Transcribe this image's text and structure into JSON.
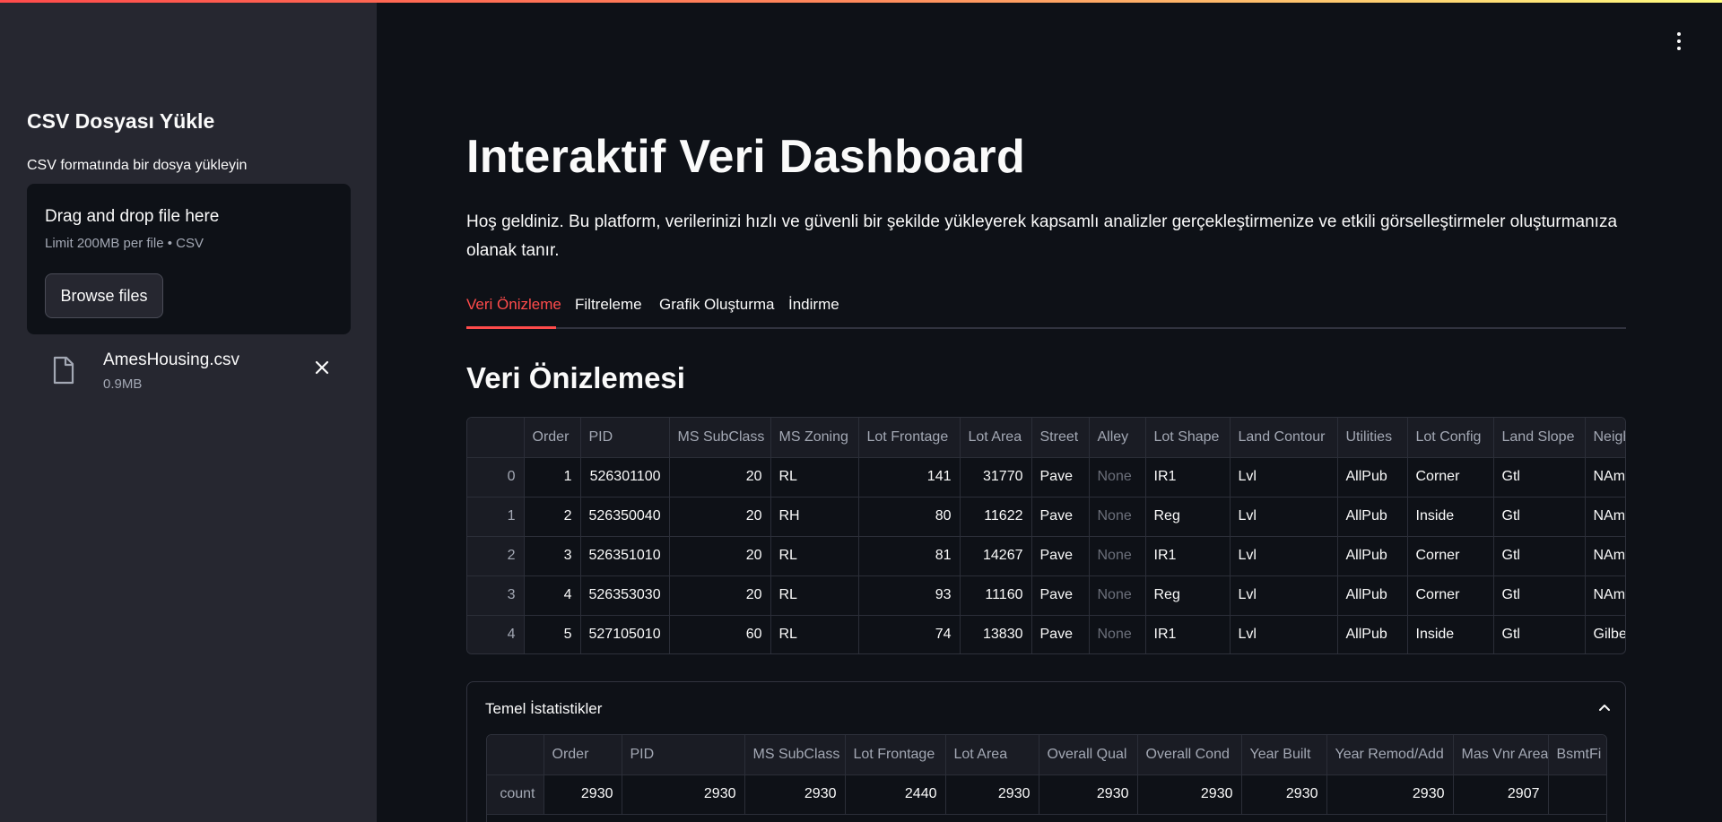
{
  "sidebar": {
    "title": "CSV Dosyası Yükle",
    "upload_label": "CSV formatında bir dosya yükleyin",
    "dropzone": {
      "title": "Drag and drop file here",
      "limit": "Limit 200MB per file • CSV",
      "browse_label": "Browse files"
    },
    "file": {
      "name": "AmesHousing.csv",
      "size": "0.9MB",
      "icon": "file-icon",
      "remove_icon": "close-icon"
    }
  },
  "main": {
    "title": "Interaktif Veri Dashboard",
    "intro": "Hoş geldiniz. Bu platform, verilerinizi hızlı ve güvenli bir şekilde yükleyerek kapsamlı analizler gerçekleştirmenize ve etkili görselleştirmeler oluşturmanıza olanak tanır.",
    "tabs": [
      {
        "label": "Veri Önizleme",
        "active": true
      },
      {
        "label": "Filtreleme",
        "active": false
      },
      {
        "label": "Grafik Oluşturma",
        "active": false
      },
      {
        "label": "İndirme",
        "active": false
      }
    ],
    "section_title": "Veri Önizlemesi",
    "preview_table": {
      "columns": [
        "",
        "Order",
        "PID",
        "MS SubClass",
        "MS Zoning",
        "Lot Frontage",
        "Lot Area",
        "Street",
        "Alley",
        "Lot Shape",
        "Land Contour",
        "Utilities",
        "Lot Config",
        "Land Slope",
        "Neigh"
      ],
      "rows": [
        [
          "0",
          "1",
          "526301100",
          "20",
          "RL",
          "141",
          "31770",
          "Pave",
          "None",
          "IR1",
          "Lvl",
          "AllPub",
          "Corner",
          "Gtl",
          "NAme"
        ],
        [
          "1",
          "2",
          "526350040",
          "20",
          "RH",
          "80",
          "11622",
          "Pave",
          "None",
          "Reg",
          "Lvl",
          "AllPub",
          "Inside",
          "Gtl",
          "NAme"
        ],
        [
          "2",
          "3",
          "526351010",
          "20",
          "RL",
          "81",
          "14267",
          "Pave",
          "None",
          "IR1",
          "Lvl",
          "AllPub",
          "Corner",
          "Gtl",
          "NAme"
        ],
        [
          "3",
          "4",
          "526353030",
          "20",
          "RL",
          "93",
          "11160",
          "Pave",
          "None",
          "Reg",
          "Lvl",
          "AllPub",
          "Corner",
          "Gtl",
          "NAme"
        ],
        [
          "4",
          "5",
          "527105010",
          "60",
          "RL",
          "74",
          "13830",
          "Pave",
          "None",
          "IR1",
          "Lvl",
          "AllPub",
          "Inside",
          "Gtl",
          "Gilbe"
        ]
      ]
    },
    "stats": {
      "title": "Temel İstatistikler",
      "chevron_icon": "chevron-up-icon",
      "columns": [
        "",
        "Order",
        "PID",
        "MS SubClass",
        "Lot Frontage",
        "Lot Area",
        "Overall Qual",
        "Overall Cond",
        "Year Built",
        "Year Remod/Add",
        "Mas Vnr Area",
        "BsmtFi"
      ],
      "rows": [
        [
          "count",
          "2930",
          "2930",
          "2930",
          "2440",
          "2930",
          "2930",
          "2930",
          "2930",
          "2930",
          "2907",
          ""
        ]
      ]
    }
  },
  "menu_icon": "more-vertical-icon",
  "colors": {
    "accent": "#ff4b4b",
    "background": "#0e1117",
    "sidebar": "#262730"
  }
}
